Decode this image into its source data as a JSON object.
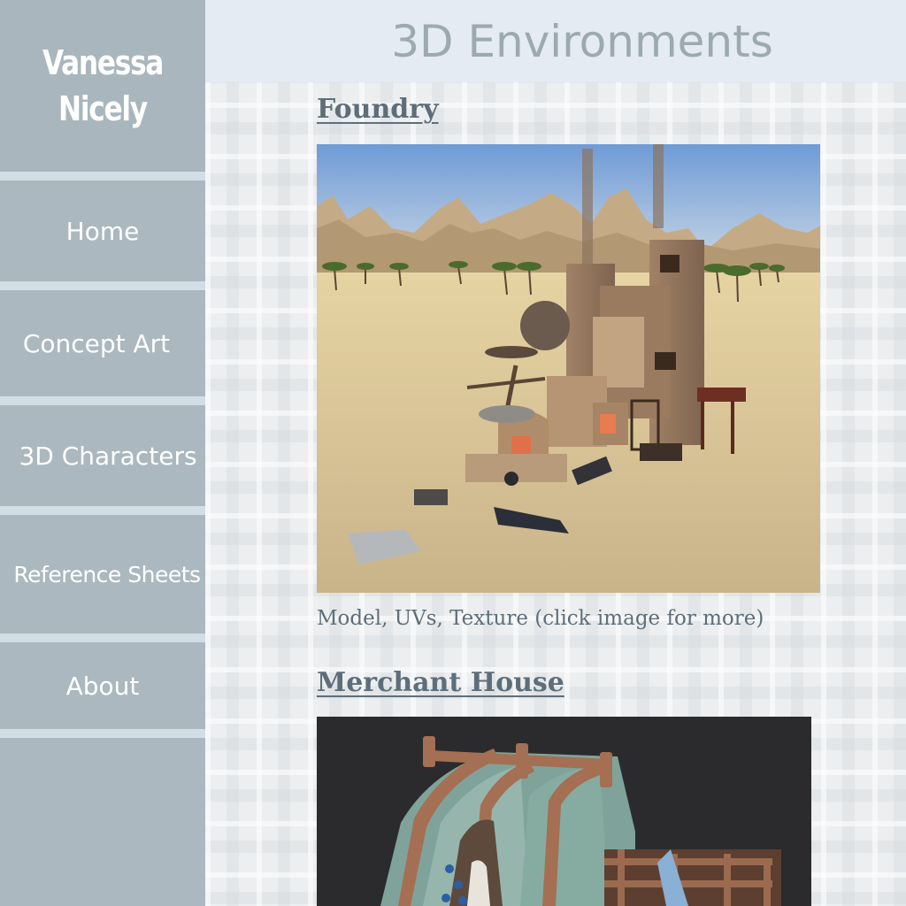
{
  "brand": {
    "line1": "Vanessa",
    "line2": "Nicely"
  },
  "nav": {
    "home": "Home",
    "concept_art": "Concept Art",
    "characters_3d": "3D Characters",
    "reference_sheets": "Reference Sheets",
    "about": "About"
  },
  "header": {
    "title": "3D Environments"
  },
  "sections": [
    {
      "title": "Foundry",
      "caption": "Model, UVs, Texture (click image for more)"
    },
    {
      "title": "Merchant House"
    }
  ],
  "colors": {
    "sidebar": "#abb8bf",
    "separator": "#d3dde4",
    "header_bg": "#e4ebf2",
    "title_text": "#9da9b1",
    "section_text": "#5d6e7a"
  }
}
